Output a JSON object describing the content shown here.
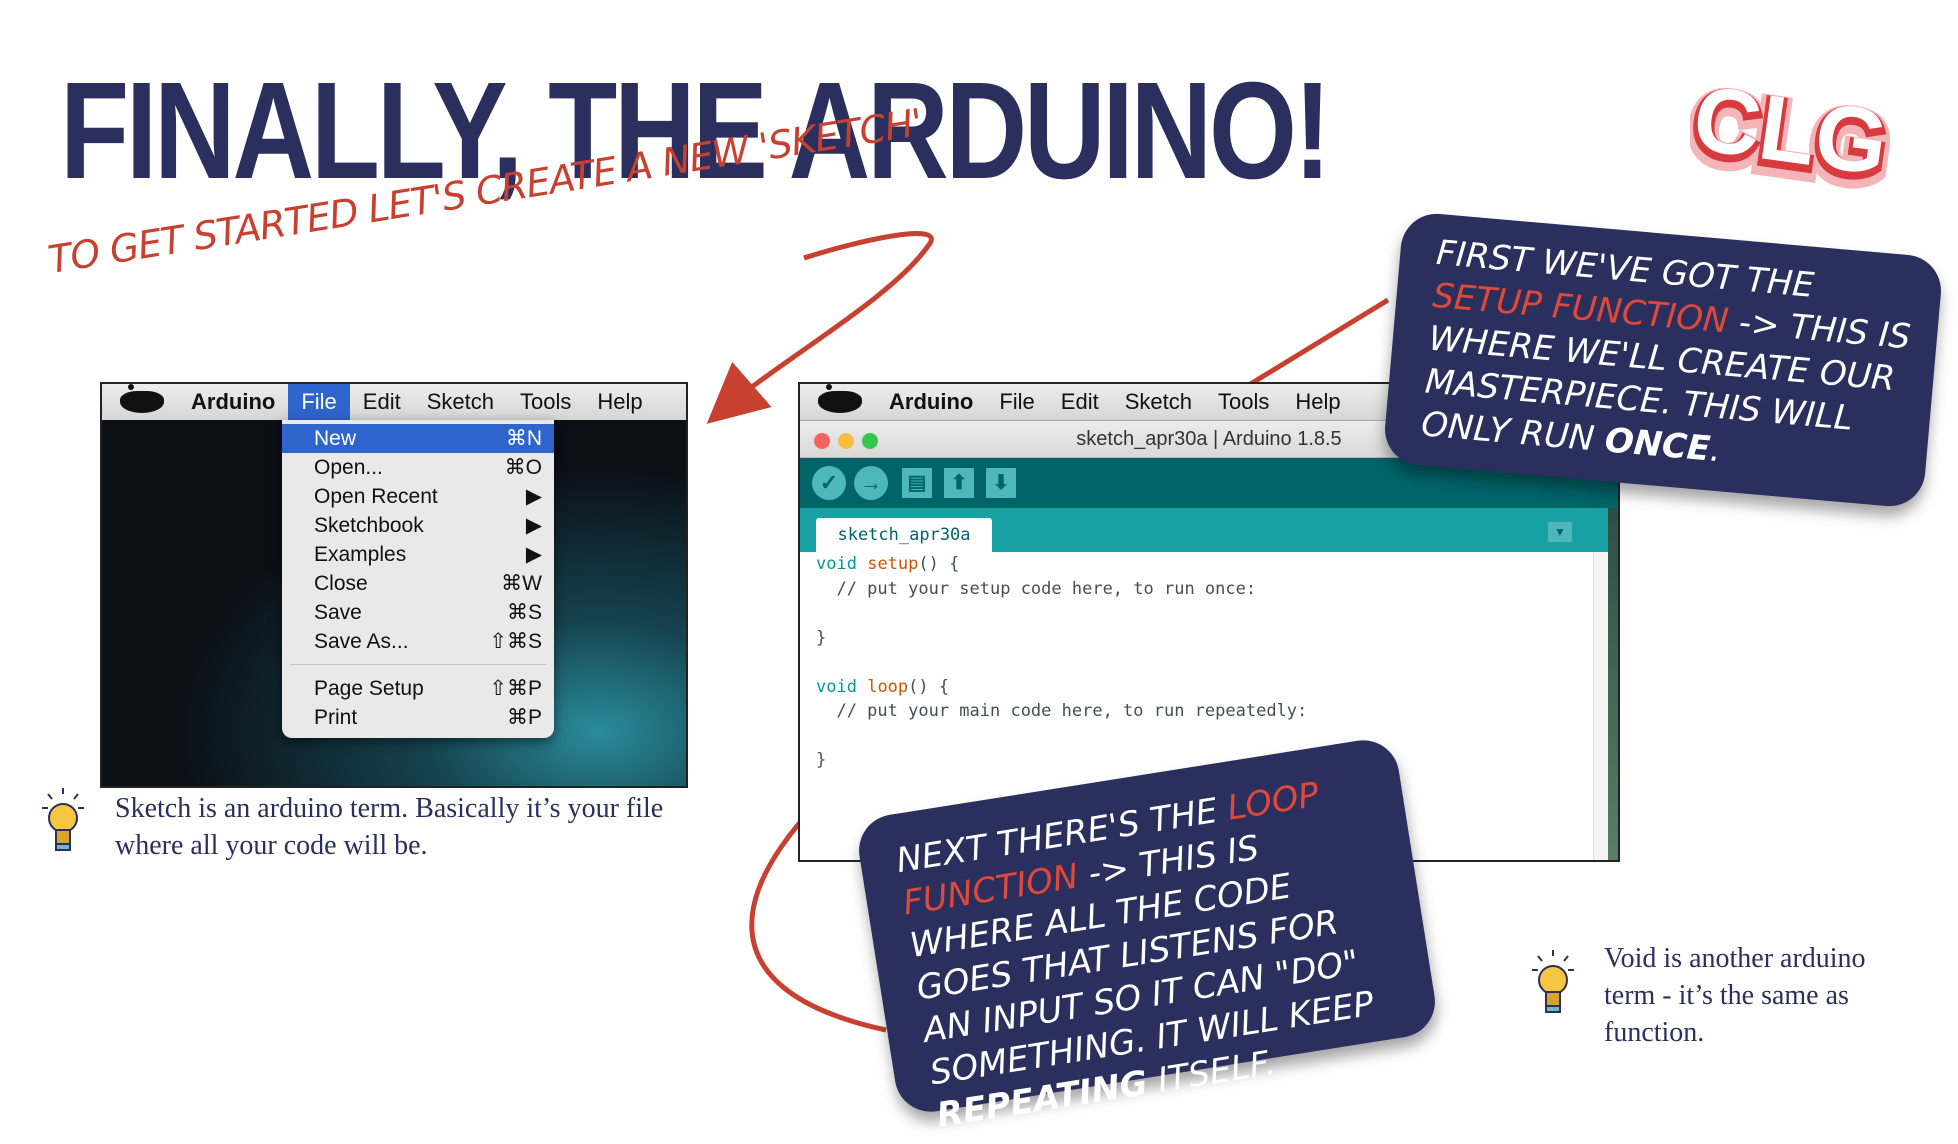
{
  "slide": {
    "title": "FINALLY, THE ARDUINO!",
    "logo_text": "CLG",
    "intro_text": "TO GET STARTED LET'S CREATE A NEW 'SKETCH'"
  },
  "menubar": {
    "app_name": "Arduino",
    "items": [
      "File",
      "Edit",
      "Sketch",
      "Tools",
      "Help"
    ]
  },
  "file_menu": {
    "items": [
      {
        "label": "New",
        "shortcut": "⌘N"
      },
      {
        "label": "Open...",
        "shortcut": "⌘O"
      },
      {
        "label": "Open Recent",
        "shortcut": "▶"
      },
      {
        "label": "Sketchbook",
        "shortcut": "▶"
      },
      {
        "label": "Examples",
        "shortcut": "▶"
      },
      {
        "label": "Close",
        "shortcut": "⌘W"
      },
      {
        "label": "Save",
        "shortcut": "⌘S"
      },
      {
        "label": "Save As...",
        "shortcut": "⇧⌘S"
      },
      {
        "label": "Page Setup",
        "shortcut": "⇧⌘P"
      },
      {
        "label": "Print",
        "shortcut": "⌘P"
      }
    ]
  },
  "tips": {
    "sketch_tip": "Sketch is an arduino term. Basically it’s your file where all your code will be.",
    "void_tip": "Void is another arduino term - it’s the same as function."
  },
  "ide": {
    "window_title": "sketch_apr30a | Arduino 1.8.5",
    "tab_name": "sketch_apr30a",
    "toolbar_icons": [
      "verify-icon",
      "upload-icon",
      "new-icon",
      "open-icon",
      "save-icon"
    ],
    "code": {
      "setup_kw": "void",
      "setup_fn": "setup",
      "setup_rest": "() {",
      "setup_comment": "  // put your setup code here, to run once:",
      "close1": "}",
      "loop_kw": "void",
      "loop_fn": "loop",
      "loop_rest": "() {",
      "loop_comment": "  // put your main code here, to run repeatedly:",
      "close2": "}"
    }
  },
  "callouts": {
    "setup": {
      "p1": "FIRST WE'VE GOT THE ",
      "p2": "SETUP FUNCTION",
      "p3": " -> THIS IS WHERE WE'LL CREATE OUR MASTERPIECE. THIS WILL ONLY RUN ",
      "p4": "ONCE",
      "p5": "."
    },
    "loop": {
      "p1": "NEXT THERE'S THE ",
      "p2": "LOOP FUNCTION",
      "p3": " -> THIS IS WHERE ALL THE CODE GOES THAT LISTENS FOR AN INPUT SO IT CAN \"DO\" SOMETHING. IT WILL KEEP ",
      "p4": "REPEATING",
      "p5": " ITSELF."
    }
  },
  "colors": {
    "navy": "#2a2f5e",
    "accent_red": "#c8402f",
    "arduino_teal": "#006468",
    "menu_highlight": "#2f64cd"
  }
}
